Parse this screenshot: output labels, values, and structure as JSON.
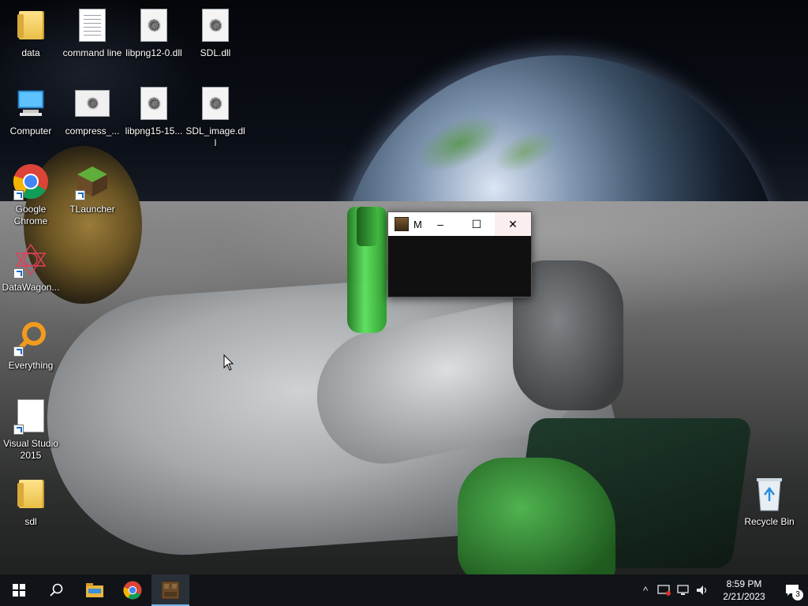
{
  "desktop": {
    "icons": [
      {
        "label": "data",
        "icon": "folder-icon"
      },
      {
        "label": "command line",
        "icon": "text-file-icon"
      },
      {
        "label": "libpng12-0.dll",
        "icon": "dll-file-icon"
      },
      {
        "label": "SDL.dll",
        "icon": "dll-file-icon"
      },
      {
        "label": "Computer",
        "icon": "computer-icon"
      },
      {
        "label": "compress_...",
        "icon": "settings-file-icon"
      },
      {
        "label": "libpng15-15...",
        "icon": "dll-file-icon"
      },
      {
        "label": "SDL_image.dll",
        "icon": "dll-file-icon"
      },
      {
        "label": "Google Chrome",
        "icon": "chrome-icon"
      },
      {
        "label": "TLauncher",
        "icon": "tlauncher-icon"
      },
      {
        "label": "DataWagon...",
        "icon": "datawagon-icon"
      },
      {
        "label": "Everything",
        "icon": "everything-search-icon"
      },
      {
        "label": "Visual Studio 2015",
        "icon": "blank-file-icon"
      },
      {
        "label": "sdl",
        "icon": "folder-icon"
      },
      {
        "label": "Recycle Bin",
        "icon": "recycle-bin-icon"
      }
    ]
  },
  "window": {
    "title": "M",
    "controls": {
      "minimize": "–",
      "maximize": "☐",
      "close": "✕"
    }
  },
  "taskbar": {
    "start": "start-icon",
    "pinned": [
      "search-icon",
      "file-explorer-icon",
      "chrome-icon",
      "minecraft-icon"
    ],
    "tray": {
      "chevron": "^",
      "time": "8:59 PM",
      "date": "2/21/2023",
      "notification_count": "3"
    }
  },
  "colors": {
    "taskbar": "#101418",
    "accent": "#76b9ed",
    "window_body": "#101010"
  }
}
